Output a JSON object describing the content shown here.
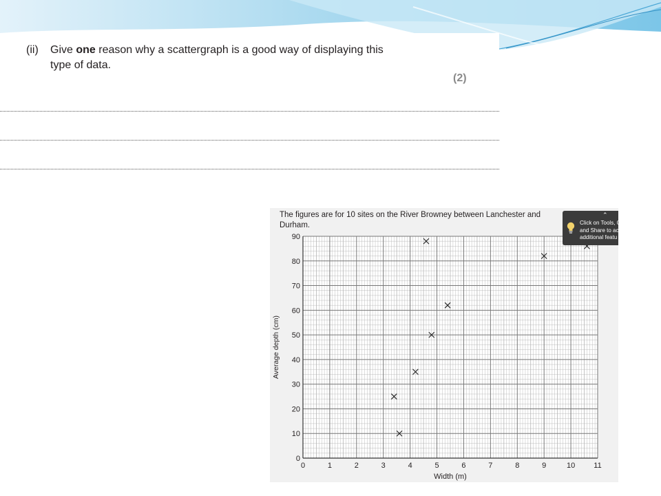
{
  "question": {
    "number": "(ii)",
    "text_before": "Give ",
    "text_bold": "one",
    "text_after": " reason why a scattergraph is a good way of displaying this",
    "line2": "type of data.",
    "marks": "(2)"
  },
  "figure": {
    "caption_line1": "The figures are for 10 sites on the River Browney between Lanchester and",
    "caption_line2": "Durham."
  },
  "tooltip": {
    "collapse_icon": "chevron-up-icon",
    "icon": "lightbulb-icon",
    "line1": "Click on Tools, C",
    "line2": "and Share to acc",
    "line3": "additional featu"
  },
  "colors": {
    "grid_major": "#777777",
    "grid_minor": "#b5b5b5",
    "marker": "#222222",
    "banner_blue": "#9fd3ec",
    "tooltip_bg": "#3b3b3b"
  },
  "chart_data": {
    "type": "scatter",
    "xlabel": "Width (m)",
    "ylabel": "Average depth (cm)",
    "xlim": [
      0,
      11
    ],
    "ylim": [
      0,
      90
    ],
    "x_ticks": [
      "0",
      "1",
      "2",
      "3",
      "4",
      "5",
      "6",
      "7",
      "8",
      "9",
      "10",
      "11"
    ],
    "y_ticks": [
      "0",
      "10",
      "20",
      "30",
      "40",
      "50",
      "60",
      "70",
      "80",
      "90"
    ],
    "marker": "x",
    "grid": true,
    "points": [
      {
        "x": 3.4,
        "y": 25
      },
      {
        "x": 3.6,
        "y": 10
      },
      {
        "x": 4.2,
        "y": 35
      },
      {
        "x": 4.6,
        "y": 88
      },
      {
        "x": 4.8,
        "y": 50
      },
      {
        "x": 5.4,
        "y": 62
      },
      {
        "x": 9.0,
        "y": 82
      },
      {
        "x": 10.6,
        "y": 86
      }
    ]
  }
}
